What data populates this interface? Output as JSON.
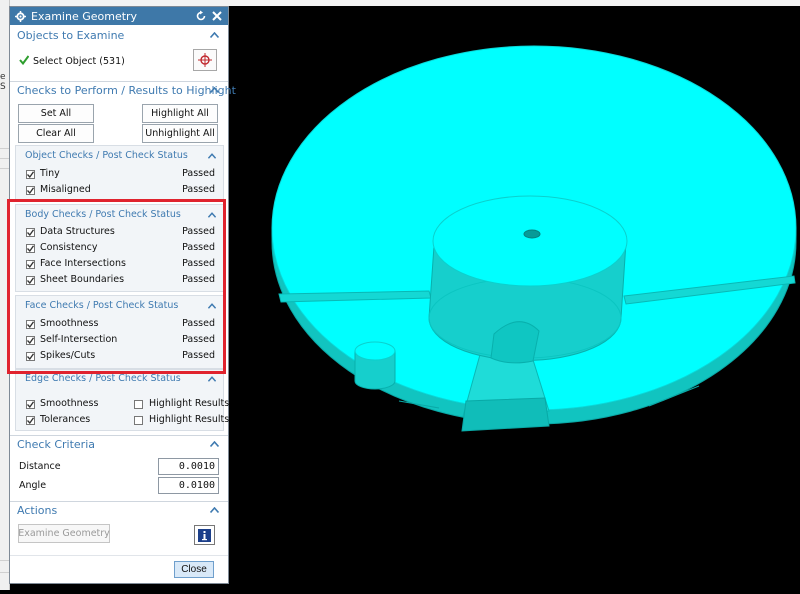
{
  "dialog": {
    "title": "Examine Geometry",
    "objects_section": {
      "header": "Objects to Examine",
      "select_label": "Select Object (531)"
    },
    "checks_section": {
      "header": "Checks to Perform / Results to Highlight",
      "set_all": "Set All",
      "highlight_all": "Highlight All",
      "clear_all": "Clear All",
      "unhighlight_all": "Unhighlight All",
      "object_checks": {
        "header": "Object Checks / Post Check Status",
        "items": [
          {
            "label": "Tiny",
            "status": "Passed",
            "checked": true
          },
          {
            "label": "Misaligned",
            "status": "Passed",
            "checked": true
          }
        ]
      },
      "body_checks": {
        "header": "Body Checks / Post Check Status",
        "items": [
          {
            "label": "Data Structures",
            "status": "Passed",
            "checked": true
          },
          {
            "label": "Consistency",
            "status": "Passed",
            "checked": true
          },
          {
            "label": "Face Intersections",
            "status": "Passed",
            "checked": true
          },
          {
            "label": "Sheet Boundaries",
            "status": "Passed",
            "checked": true
          }
        ]
      },
      "face_checks": {
        "header": "Face Checks / Post Check Status",
        "items": [
          {
            "label": "Smoothness",
            "status": "Passed",
            "checked": true
          },
          {
            "label": "Self-Intersection",
            "status": "Passed",
            "checked": true
          },
          {
            "label": "Spikes/Cuts",
            "status": "Passed",
            "checked": true
          }
        ]
      },
      "edge_checks": {
        "header": "Edge Checks / Post Check Status",
        "items": [
          {
            "label": "Smoothness",
            "highlight_label": "Highlight Results",
            "checked": true,
            "highlight_checked": false
          },
          {
            "label": "Tolerances",
            "highlight_label": "Highlight Results",
            "checked": true,
            "highlight_checked": false
          }
        ]
      }
    },
    "criteria_section": {
      "header": "Check Criteria",
      "distance_label": "Distance",
      "distance_value": "0.0010",
      "angle_label": "Angle",
      "angle_value": "0.0100"
    },
    "actions_section": {
      "header": "Actions",
      "examine_button": "Examine Geometry"
    },
    "close_button": "Close"
  },
  "left_strip": {
    "text": "e S"
  },
  "colors": {
    "title_bar": "#3e78a8",
    "section_header_text": "#3f7ab0",
    "highlight_frame": "#e0232e",
    "model_top": "#00ffff",
    "model_side": "#11c4c0",
    "viewport_background": "#000000",
    "checkmark_green": "#2e9e2e"
  },
  "icons": {
    "title": "gear-icon",
    "reset": "reset-icon",
    "close": "close-icon",
    "select_ok": "checkmark-icon",
    "select_object": "crosshair-icon",
    "info": "info-icon",
    "section_toggle": "chevron-up-icon"
  }
}
